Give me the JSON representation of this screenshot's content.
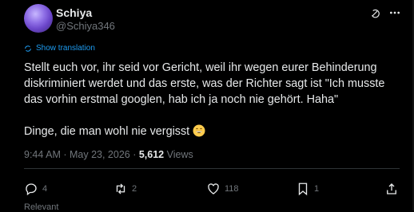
{
  "author": {
    "name": "Schiya",
    "handle": "@Schiya346"
  },
  "translation": {
    "label": "Show translation"
  },
  "tweet": {
    "text": "Stellt euch vor, ihr seid vor Gericht, weil ihr wegen eurer Behinderung diskriminiert werdet und das erste, was der Richter sagt ist \"Ich musste das vorhin erstmal googlen, hab ich ja noch nie gehört. Haha\"\n\nDinge, die man wohl nie vergisst "
  },
  "meta": {
    "time": "9:44 AM",
    "date": "May 23, 2026",
    "separator": " · ",
    "views_count": "5,612",
    "views_label": "Views"
  },
  "actions": {
    "replies": "4",
    "reposts": "2",
    "likes": "118",
    "bookmarks": "1"
  },
  "section_label": "Relevant",
  "colors": {
    "accent": "#1d9bf0",
    "text": "#e7e9ea",
    "muted": "#71767b",
    "background": "#000000"
  }
}
